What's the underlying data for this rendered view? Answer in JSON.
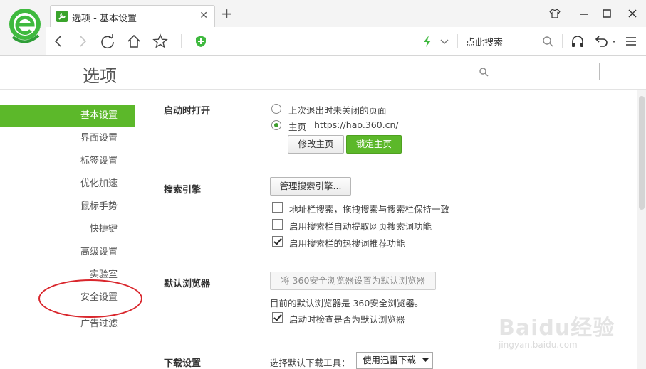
{
  "browser": {
    "tab_title": "选项 - 基本设置",
    "search_placeholder": "点此搜索"
  },
  "page": {
    "title": "选项"
  },
  "sidebar": {
    "items": [
      {
        "label": "基本设置",
        "active": true
      },
      {
        "label": "界面设置"
      },
      {
        "label": "标签设置"
      },
      {
        "label": "优化加速"
      },
      {
        "label": "鼠标手势"
      },
      {
        "label": "快捷键"
      },
      {
        "label": "高级设置"
      },
      {
        "label": "实验室"
      },
      {
        "label": "安全设置"
      },
      {
        "label": "广告过滤"
      }
    ]
  },
  "startup": {
    "label": "启动时打开",
    "option_last": "上次退出时未关闭的页面",
    "option_home": "主页",
    "home_url": "https://hao.360.cn/",
    "modify_button": "修改主页",
    "lock_button": "锁定主页"
  },
  "search_engine": {
    "label": "搜索引擎",
    "manage_button": "管理搜索引擎...",
    "options": [
      {
        "label": "地址栏搜索，拖拽搜索与搜索栏保持一致",
        "checked": false
      },
      {
        "label": "启用搜索栏自动提取网页搜索词功能",
        "checked": false
      },
      {
        "label": "启用搜索栏的热搜词推荐功能",
        "checked": true
      }
    ]
  },
  "default_browser": {
    "label": "默认浏览器",
    "set_button": "将 360安全浏览器设置为默认浏览器",
    "status": "目前的默认浏览器是 360安全浏览器。",
    "check_label": "启动时检查是否为默认浏览器",
    "check_on": true
  },
  "download": {
    "label": "下载设置",
    "tool_label": "选择默认下载工具：",
    "tool_value": "使用迅雷下载"
  },
  "watermark": {
    "main": "Baidu经验",
    "sub": "jingyan.baidu.com"
  },
  "colors": {
    "accent": "#5cb82a",
    "highlight_ring": "#d9262c"
  }
}
